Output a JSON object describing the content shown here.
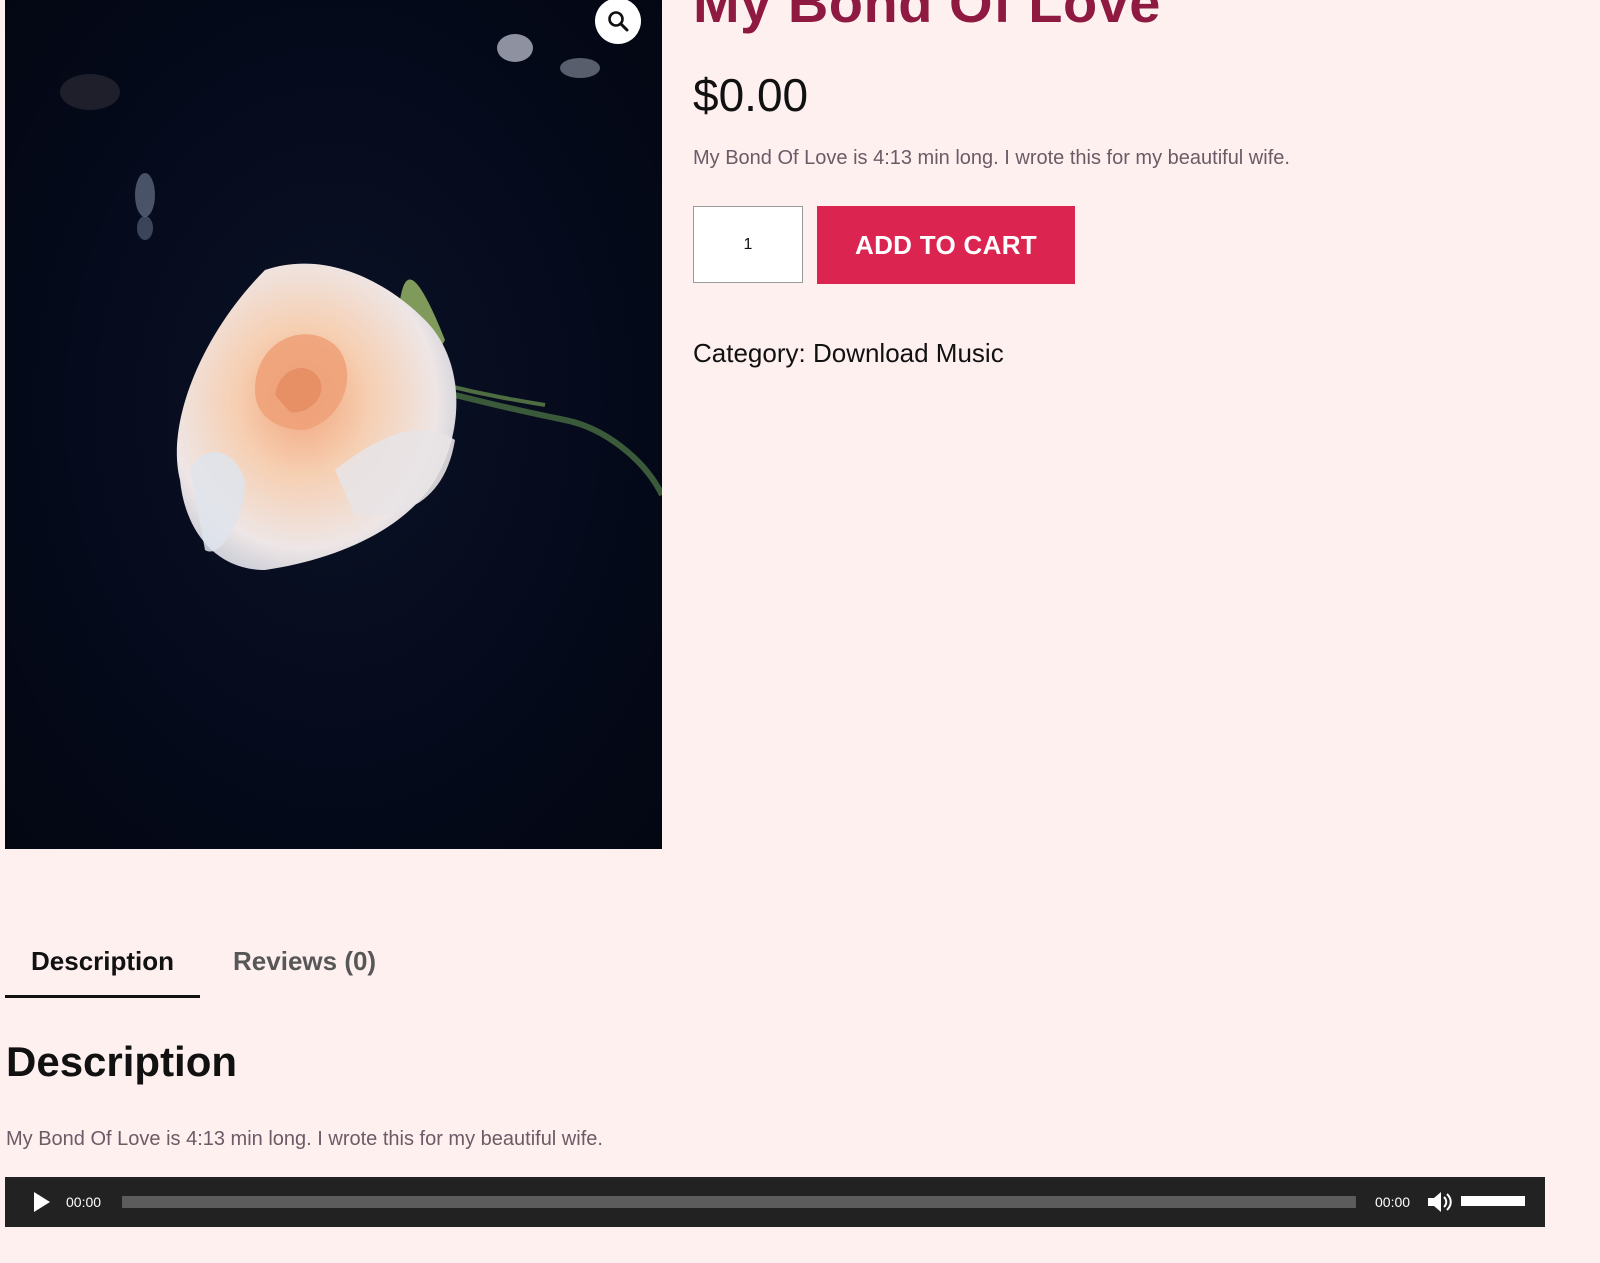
{
  "product": {
    "title": "My Bond Of Love",
    "price": "$0.00",
    "short_description": "My Bond Of Love is 4:13 min long.  I wrote this for my beautiful wife.",
    "image_subject": "rose-photo",
    "zoom_icon": "magnifier-icon"
  },
  "cart": {
    "quantity": "1",
    "add_to_cart_label": "ADD TO CART"
  },
  "category": {
    "prefix": "Category: ",
    "name": "Download Music"
  },
  "tabs": [
    {
      "label": "Description",
      "active": true
    },
    {
      "label": "Reviews (0)",
      "active": false
    }
  ],
  "description": {
    "heading": "Description",
    "text": "My Bond Of Love is 4:13 min long.  I wrote this for my beautiful wife."
  },
  "player": {
    "current_time": "00:00",
    "duration": "00:00",
    "play_icon": "play-icon",
    "mute_icon": "speaker-icon",
    "progress": 0,
    "volume": 1
  },
  "colors": {
    "background": "#fff0f0",
    "title": "#8e1a42",
    "button": "#dc2450",
    "player": "#222222"
  }
}
